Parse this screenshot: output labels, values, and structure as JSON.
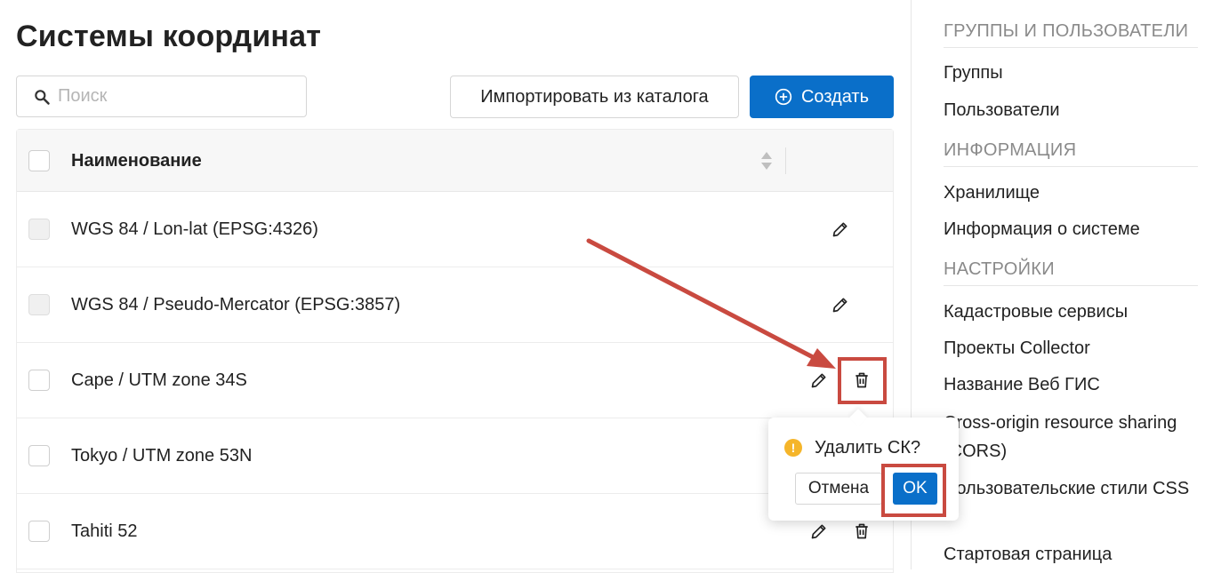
{
  "page": {
    "title": "Системы координат"
  },
  "toolbar": {
    "search_placeholder": "Поиск",
    "import_label": "Импортировать из каталога",
    "create_label": "Создать",
    "create_color": "#0a6fc9"
  },
  "table": {
    "column_name": "Наименование",
    "rows": [
      {
        "name": "WGS 84 / Lon-lat (EPSG:4326)",
        "checkbox_disabled": true,
        "actions": [
          "edit"
        ]
      },
      {
        "name": "WGS 84 / Pseudo-Mercator (EPSG:3857)",
        "checkbox_disabled": true,
        "actions": [
          "edit"
        ]
      },
      {
        "name": "Cape / UTM zone 34S",
        "checkbox_disabled": false,
        "actions": [
          "edit",
          "delete"
        ]
      },
      {
        "name": "Tokyo / UTM zone 53N",
        "checkbox_disabled": false,
        "actions": [
          "edit",
          "delete"
        ]
      },
      {
        "name": "Tahiti 52",
        "checkbox_disabled": false,
        "actions": [
          "edit",
          "delete"
        ]
      }
    ]
  },
  "confirm_popover": {
    "message": "Удалить СК?",
    "cancel_label": "Отмена",
    "ok_label": "OK",
    "warning_icon": "exclamation-circle-icon",
    "warning_color": "#f5b52a"
  },
  "sidebar": {
    "sections": [
      {
        "title": "ГРУППЫ И ПОЛЬЗОВАТЕЛИ",
        "items": [
          "Группы",
          "Пользователи"
        ]
      },
      {
        "title": "ИНФОРМАЦИЯ",
        "items": [
          "Хранилище",
          "Информация о системе"
        ]
      },
      {
        "title": "НАСТРОЙКИ",
        "items": [
          "Кадастровые сервисы",
          "Проекты Collector",
          "Название Веб ГИС",
          "Cross-origin resource sharing (CORS)",
          "Пользовательские стили CSS",
          "Стартовая страница"
        ]
      }
    ]
  },
  "annotation": {
    "highlight_color": "#c94a40"
  }
}
